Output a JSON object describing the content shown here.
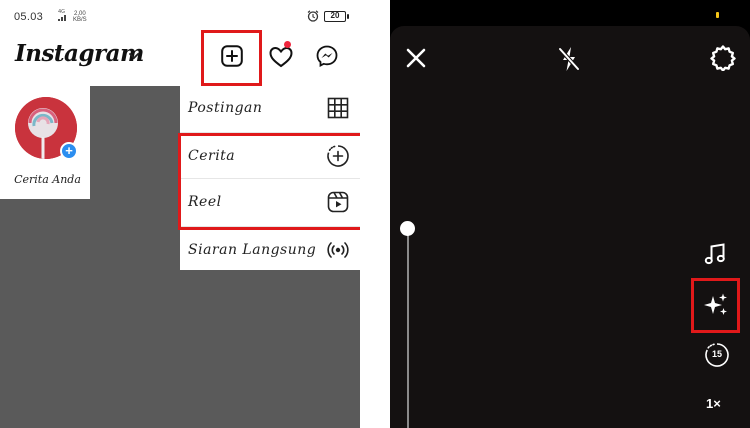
{
  "status_bar": {
    "time": "05.03",
    "network_type": "4G",
    "net_speed_value": "2,00",
    "net_speed_unit": "KB/S",
    "battery": "20"
  },
  "header": {
    "app_title": "Instagram"
  },
  "story": {
    "label": "Cerita Anda"
  },
  "create_menu": {
    "items": [
      {
        "label": "Postingan",
        "icon": "grid-icon"
      },
      {
        "label": "Cerita",
        "icon": "story-add-icon"
      },
      {
        "label": "Reel",
        "icon": "reel-icon"
      },
      {
        "label": "Siaran Langsung",
        "icon": "live-icon"
      }
    ]
  },
  "camera": {
    "zoom_label": "1×",
    "timer_label": "15"
  },
  "colors": {
    "highlight": "#e0191a",
    "notification_dot": "#f0263d",
    "add_story_badge": "#2b8ef0",
    "camera_bg": "#141111",
    "overlay_gray": "#5a5a5a"
  }
}
